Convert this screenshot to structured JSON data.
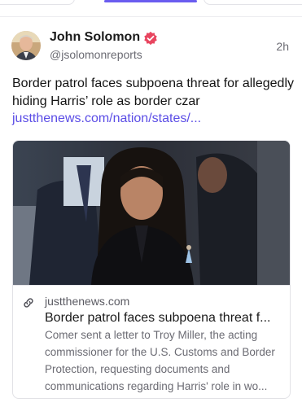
{
  "post": {
    "author_name": "John Solomon",
    "handle": "@jsolomonreports",
    "time": "2h",
    "text": "Border patrol faces subpoena threat for allegedly hiding Harris’ role as border czar",
    "link_text": "justthenews.com/nation/states/...",
    "avatar": "author-avatar-photo",
    "verified_icon": "verified-badge-icon",
    "colors": {
      "link": "#5b4de6",
      "verified": "#e8455f",
      "active_tab": "#6a5cf0"
    }
  },
  "card": {
    "image": "photo of woman in dark clothing",
    "link_icon": "link-icon",
    "domain": "justthenews.com",
    "title": "Border patrol faces subpoena threat f...",
    "description": "Comer sent a letter to Troy Miller, the acting commissioner for the U.S. Customs and Border Protection, requesting documents and communications regarding Harris' role in wo..."
  }
}
